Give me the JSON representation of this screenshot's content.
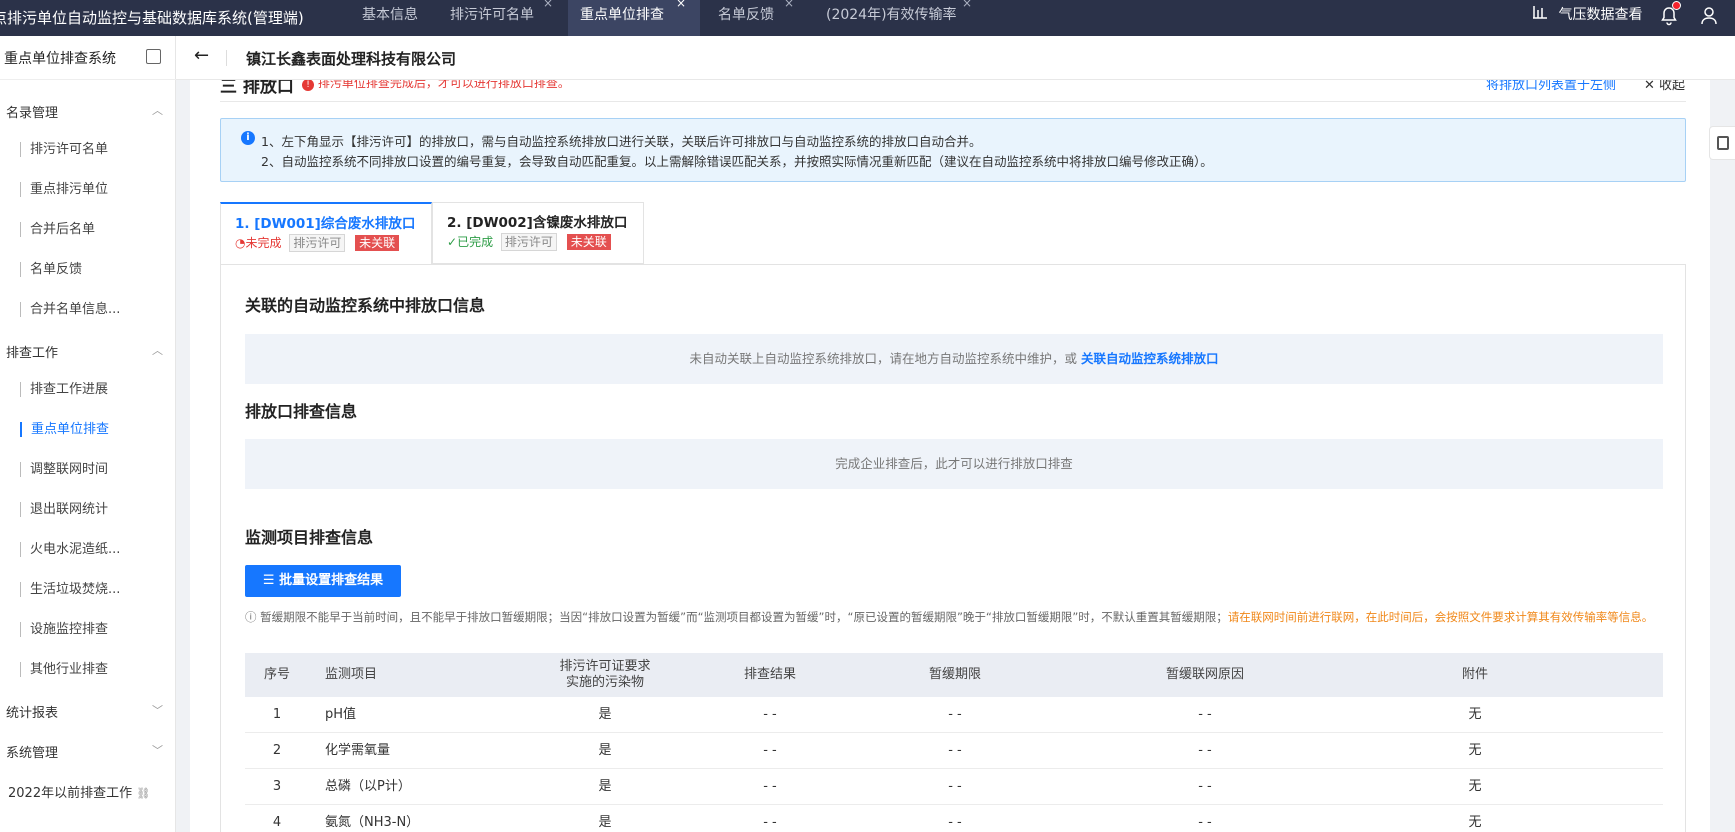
{
  "app": {
    "title": "点排污单位自动监控与基础数据库系统(管理端)",
    "tabs": [
      {
        "label": "基本信息",
        "closable": false
      },
      {
        "label": "排污许可名单",
        "closable": true
      },
      {
        "label": "重点单位排查",
        "closable": true,
        "active": true
      },
      {
        "label": "名单反馈",
        "closable": true
      },
      {
        "label": "(2024年)有效传输率",
        "closable": true
      }
    ],
    "close_glyph": "×",
    "right_link": "气压数据查看"
  },
  "sidebar": {
    "title": "重点单位排查系统",
    "groups": [
      {
        "label": "名录管理",
        "expanded": true,
        "items": [
          "排污许可名单",
          "重点排污单位",
          "合并后名单",
          "名单反馈",
          "合并名单信息..."
        ]
      },
      {
        "label": "排查工作",
        "expanded": true,
        "items": [
          "排查工作进展",
          "重点单位排查",
          "调整联网时间",
          "退出联网统计",
          "火电水泥造纸...",
          "生活垃圾焚烧...",
          "设施监控排查",
          "其他行业排查"
        ]
      },
      {
        "label": "统计报表",
        "expanded": false,
        "items": []
      },
      {
        "label": "系统管理",
        "expanded": false,
        "items": []
      }
    ],
    "active_item": "重点单位排查",
    "footer_link": "2022年以前排查工作"
  },
  "header": {
    "company": "镇江长鑫表面处理科技有限公司"
  },
  "section": {
    "title": "三 排放口",
    "hint": "排污单位排查完成后，才可以进行排放口排查。",
    "right_link": "将排放口列表置于左侧",
    "collapse": "收起"
  },
  "notice": {
    "line1": "1、左下角显示【排污许可】的排放口，需与自动监控系统排放口进行关联，关联后许可排放口与自动监控系统的排放口自动合并。",
    "line2": "2、自动监控系统不同排放口设置的编号重复，会导致自动匹配重复。以上需解除错误匹配关系，并按照实际情况重新匹配（建议在自动监控系统中将排放口编号修改正确）。"
  },
  "outlet_tabs": [
    {
      "title": "1. [DW001]综合废水排放口",
      "status": "未完成",
      "source": "排污许可",
      "link": "未关联",
      "active": true
    },
    {
      "title": "2. [DW002]含镍废水排放口",
      "status": "已完成",
      "source": "排污许可",
      "link": "未关联",
      "active": false
    }
  ],
  "assoc": {
    "title": "关联的自动监控系统中排放口信息",
    "message": "未自动关联上自动监控系统排放口，请在地方自动监控系统中维护，或",
    "link": "关联自动监控系统排放口"
  },
  "outlet_check": {
    "title": "排放口排查信息",
    "message": "完成企业排查后，此才可以进行排放口排查"
  },
  "monitor": {
    "title": "监测项目排查信息",
    "batch_button": "批量设置排查结果",
    "tip": "暂缓期限不能早于当前时间，且不能早于排放口暂缓期限；当因“排放口设置为暂缓”而“监测项目都设置为暂缓”时，“原已设置的暂缓期限”晚于“排放口暂缓期限”时，不默认重置其暂缓期限；",
    "tip_orange": "请在联网时间前进行联网，在此时间后，会按照文件要求计算其有效传输率等信息。",
    "columns": [
      "序号",
      "监测项目",
      "排污许可证要求实施的污染物",
      "排查结果",
      "暂缓期限",
      "暂缓联网原因",
      "附件"
    ],
    "rows": [
      [
        "1",
        "pH值",
        "是",
        "- -",
        "- -",
        "- -",
        "无"
      ],
      [
        "2",
        "化学需氧量",
        "是",
        "- -",
        "- -",
        "- -",
        "无"
      ],
      [
        "3",
        "总磷（以P计）",
        "是",
        "- -",
        "- -",
        "- -",
        "无"
      ],
      [
        "4",
        "氨氮（NH3-N）",
        "是",
        "- -",
        "- -",
        "- -",
        "无"
      ]
    ]
  }
}
